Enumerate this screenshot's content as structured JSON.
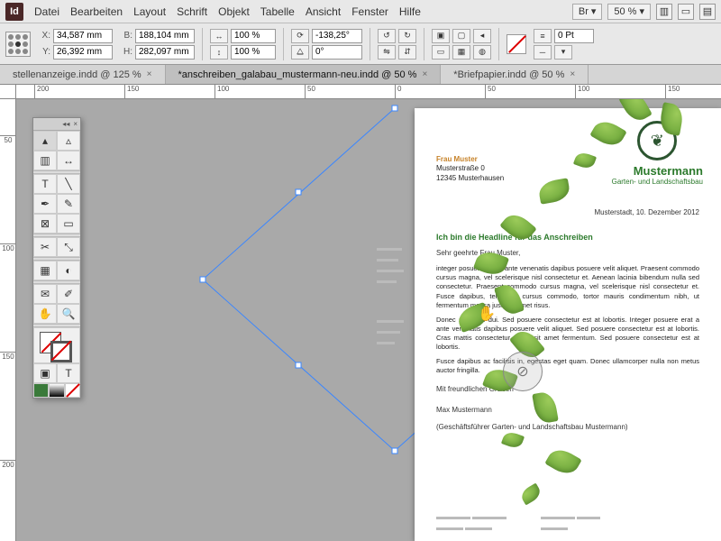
{
  "app": {
    "id": "Id"
  },
  "menu": [
    "Datei",
    "Bearbeiten",
    "Layout",
    "Schrift",
    "Objekt",
    "Tabelle",
    "Ansicht",
    "Fenster",
    "Hilfe"
  ],
  "menubar_right": {
    "mode": "Br",
    "zoom": "50 %"
  },
  "control": {
    "x": "34,587 mm",
    "y": "26,392 mm",
    "w": "188,104 mm",
    "h": "282,097 mm",
    "scale_x": "100 %",
    "scale_y": "100 %",
    "rotate": "-138,25°",
    "shear": "0°",
    "stroke": "0 Pt"
  },
  "tabs": [
    {
      "label": "stellenanzeige.indd @ 125 %",
      "close": "×"
    },
    {
      "label": "*anschreiben_galabau_mustermann-neu.indd @ 50 %",
      "close": "×",
      "active": true
    },
    {
      "label": "*Briefpapier.indd @ 50 %",
      "close": "×"
    }
  ],
  "ruler_h": [
    "200",
    "150",
    "100",
    "50",
    "0",
    "50",
    "100",
    "150"
  ],
  "ruler_v": [
    "50",
    "100",
    "150",
    "200"
  ],
  "page": {
    "recipient_hl": "Frau Muster",
    "recipient_l2": "Musterstraße 0",
    "recipient_l3": "12345 Musterhausen",
    "company": "Mustermann",
    "company_sub": "Garten- und Landschaftsbau",
    "placeline": "Musterstadt, 10. Dezember 2012",
    "headline": "Ich bin die Headline für das Anschreiben",
    "greeting": "Sehr geehrte Frau Muster,",
    "p1": "integer posuere erat a ante venenatis dapibus posuere velit aliquet. Praesent commodo cursus magna, vel scelerisque nisl consectetur et. Aenean lacinia bibendum nulla sed consectetur. Praesent commodo cursus magna, vel scelerisque nisl consectetur et. Fusce dapibus, tellus ac cursus commodo, tortor mauris condimentum nibh, ut fermentum massa justo sit amet risus.",
    "p2": "Donec sed odio dui. Sed posuere consectetur est at lobortis. Integer posuere erat a ante venenatis dapibus posuere velit aliquet. Sed posuere consectetur est at lobortis. Cras mattis consectetur purus sit amet fermentum. Sed posuere consectetur est at lobortis.",
    "p3": "Fusce dapibus ac facilisis in, egestas eget quam. Donec ullamcorper nulla non metus auctor fringilla.",
    "closing1": "Mit freundlichen Grüßen",
    "sig1": "Max Mustermann",
    "sig2": "(Geschäftsführer Garten- und Landschaftsbau Mustermann)"
  }
}
